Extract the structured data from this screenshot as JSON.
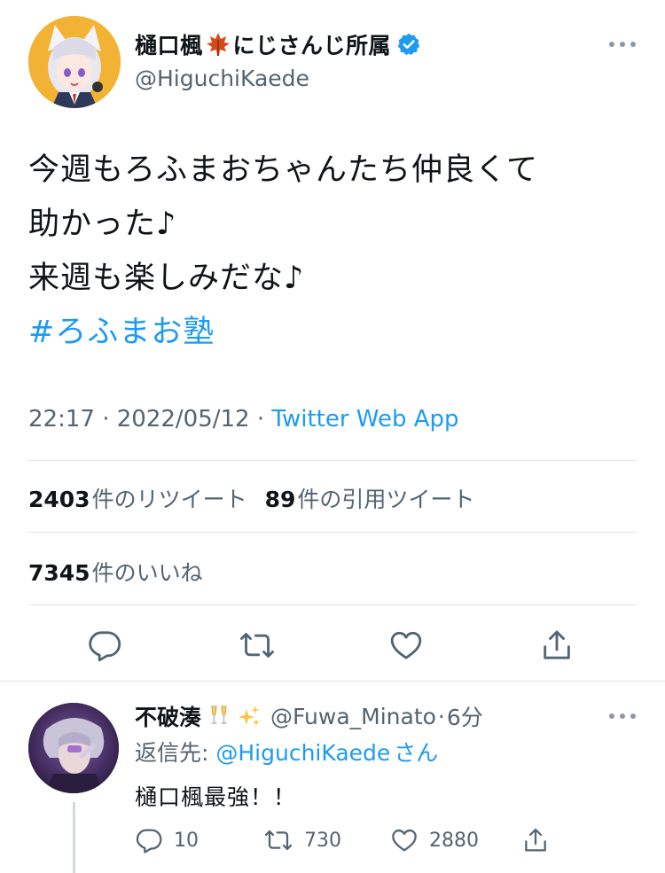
{
  "tweet": {
    "author_name": "樋口楓",
    "author_name_suffix": "にじさんじ所属",
    "name_emoji": "🍁",
    "handle": "@HiguchiKaede",
    "text_lines": [
      "今週もろふまおちゃんたち仲良くて",
      "助かった♪",
      "来週も楽しみだな♪"
    ],
    "hashtag": "#ろふまお塾",
    "time": "22:17",
    "separator": " · ",
    "date": "2022/05/12",
    "source_app": "Twitter Web App",
    "retweets_count": "2403",
    "retweets_label": "件のリツイート",
    "quotes_count": "89",
    "quotes_label": "件の引用ツイート",
    "likes_count": "7345",
    "likes_label": "件のいいね"
  },
  "reply": {
    "author_name": "不破湊",
    "name_emojis": "🥂 ✨",
    "handle": "@Fuwa_Minato",
    "dot": "·",
    "time": "6分",
    "reply_to_prefix": "返信先: ",
    "reply_to_mention": "@HiguchiKaede",
    "reply_to_suffix": "さん",
    "text": "樋口楓最強！！",
    "reply_count": "10",
    "retweet_count": "730",
    "like_count": "2880"
  },
  "colors": {
    "accent": "#1d9bf0",
    "secondary_text": "#536471",
    "divider": "#dfe3e6",
    "verified": "#1d9bf0"
  },
  "icons": [
    "verified-badge-icon",
    "more-icon",
    "reply-icon",
    "retweet-icon",
    "like-icon",
    "share-icon"
  ]
}
